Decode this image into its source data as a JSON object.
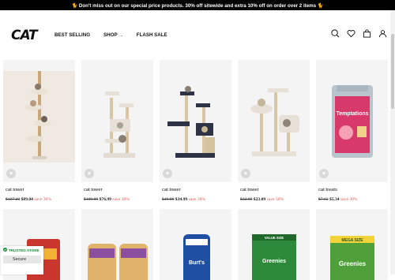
{
  "announcement": "🐈 Don't miss out on our special price products. 30% off sitewide and extra 10% off on order over 2 items 🐈",
  "header": {
    "logo": "CAT",
    "nav": [
      {
        "label": "BEST SELLING"
      },
      {
        "label": "SHOP",
        "chevron": "⌄"
      },
      {
        "label": "FLASH SALE"
      }
    ],
    "icons": [
      "search-icon",
      "heart-icon",
      "bag-icon",
      "user-icon"
    ]
  },
  "products": [
    {
      "title": "cat tower",
      "old_price": "$127.20",
      "new_price": "$89.04",
      "save": "save 30%"
    },
    {
      "title": "cat tower",
      "old_price": "$109.99",
      "new_price": "$76.99",
      "save": "save 30%"
    },
    {
      "title": "cat tower",
      "old_price": "$49.99",
      "new_price": "$34.99",
      "save": "save 30%"
    },
    {
      "title": "cat tower",
      "old_price": "$32.99",
      "new_price": "$23.09",
      "save": "save 30%"
    },
    {
      "title": "cat treats",
      "old_price": "$7.63",
      "new_price": "$5.34",
      "save": "save 30%"
    }
  ],
  "product_images_text": {
    "temptations": "Temptations",
    "value_size": "VALUE SIZE",
    "greenies": "Greenies",
    "mega_size": "MEGA SIZE",
    "burts": "Burt's"
  },
  "trusted": {
    "label": "TRUSTED STORE",
    "secure": "Secure"
  },
  "colors": {
    "accent_save": "#d9534f",
    "trusted_green": "#1a8a3a",
    "announce_bg": "#000000"
  }
}
